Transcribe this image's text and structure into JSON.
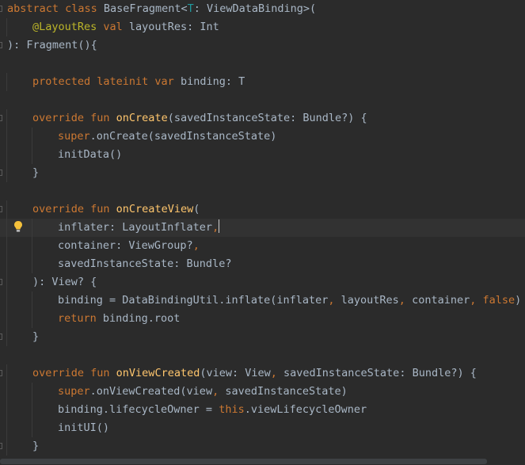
{
  "editor": {
    "language": "Kotlin",
    "theme_colors": {
      "background": "#2b2b2b",
      "keyword": "#cc7832",
      "annotation": "#bbb529",
      "type_parameter": "#20999d",
      "function_declaration": "#ffc66d",
      "plain": "#a9b7c6",
      "current_line": "#323232"
    },
    "current_line": 12,
    "gutter_icons": [
      {
        "line": 12,
        "icon": "intention-bulb-icon"
      }
    ],
    "lines": [
      {
        "indent": 0,
        "fold": true,
        "tokens": [
          {
            "t": "abstract class ",
            "c": "kw"
          },
          {
            "t": "BaseFragment<",
            "c": "pl"
          },
          {
            "t": "T",
            "c": "tp"
          },
          {
            "t": ": ViewDataBinding>(",
            "c": "pl"
          }
        ]
      },
      {
        "indent": 1,
        "tokens": [
          {
            "t": "@LayoutRes ",
            "c": "ann"
          },
          {
            "t": "val ",
            "c": "kw"
          },
          {
            "t": "layoutRes: Int",
            "c": "pl"
          }
        ]
      },
      {
        "indent": 0,
        "fold": true,
        "tokens": [
          {
            "t": "): Fragment(){",
            "c": "pl"
          }
        ]
      },
      {
        "indent": 0,
        "tokens": []
      },
      {
        "indent": 1,
        "tokens": [
          {
            "t": "protected lateinit var ",
            "c": "kw"
          },
          {
            "t": "binding: T",
            "c": "pl"
          }
        ]
      },
      {
        "indent": 0,
        "tokens": []
      },
      {
        "indent": 1,
        "fold": true,
        "tokens": [
          {
            "t": "override fun ",
            "c": "kw"
          },
          {
            "t": "onCreate",
            "c": "fn"
          },
          {
            "t": "(savedInstanceState: Bundle?) {",
            "c": "pl"
          }
        ]
      },
      {
        "indent": 2,
        "tokens": [
          {
            "t": "super",
            "c": "kw"
          },
          {
            "t": ".onCreate(savedInstanceState)",
            "c": "pl"
          }
        ]
      },
      {
        "indent": 2,
        "tokens": [
          {
            "t": "initData()",
            "c": "pl"
          }
        ]
      },
      {
        "indent": 1,
        "fold": true,
        "tokens": [
          {
            "t": "}",
            "c": "pl"
          }
        ]
      },
      {
        "indent": 0,
        "tokens": []
      },
      {
        "indent": 1,
        "fold": true,
        "tokens": [
          {
            "t": "override fun ",
            "c": "kw"
          },
          {
            "t": "onCreateView",
            "c": "fn"
          },
          {
            "t": "(",
            "c": "pl"
          }
        ]
      },
      {
        "indent": 2,
        "caret": true,
        "tokens": [
          {
            "t": "inflater: LayoutInflater",
            "c": "pl"
          },
          {
            "t": ",",
            "c": "kw"
          }
        ]
      },
      {
        "indent": 2,
        "tokens": [
          {
            "t": "container: ViewGroup?",
            "c": "pl"
          },
          {
            "t": ",",
            "c": "kw"
          }
        ]
      },
      {
        "indent": 2,
        "tokens": [
          {
            "t": "savedInstanceState: Bundle?",
            "c": "pl"
          }
        ]
      },
      {
        "indent": 1,
        "fold": true,
        "tokens": [
          {
            "t": "): View? {",
            "c": "pl"
          }
        ]
      },
      {
        "indent": 2,
        "tokens": [
          {
            "t": "binding = DataBindingUtil.inflate(inflater",
            "c": "pl"
          },
          {
            "t": ", ",
            "c": "kw"
          },
          {
            "t": "layoutRes",
            "c": "pl"
          },
          {
            "t": ", ",
            "c": "kw"
          },
          {
            "t": "container",
            "c": "pl"
          },
          {
            "t": ", ",
            "c": "kw"
          },
          {
            "t": "false",
            "c": "kw"
          },
          {
            "t": ")",
            "c": "pl"
          }
        ]
      },
      {
        "indent": 2,
        "tokens": [
          {
            "t": "return ",
            "c": "kw"
          },
          {
            "t": "binding.root",
            "c": "pl"
          }
        ]
      },
      {
        "indent": 1,
        "fold": true,
        "tokens": [
          {
            "t": "}",
            "c": "pl"
          }
        ]
      },
      {
        "indent": 0,
        "tokens": []
      },
      {
        "indent": 1,
        "fold": true,
        "tokens": [
          {
            "t": "override fun ",
            "c": "kw"
          },
          {
            "t": "onViewCreated",
            "c": "fn"
          },
          {
            "t": "(view: View",
            "c": "pl"
          },
          {
            "t": ", ",
            "c": "kw"
          },
          {
            "t": "savedInstanceState: Bundle?) {",
            "c": "pl"
          }
        ]
      },
      {
        "indent": 2,
        "tokens": [
          {
            "t": "super",
            "c": "kw"
          },
          {
            "t": ".onViewCreated(view",
            "c": "pl"
          },
          {
            "t": ", ",
            "c": "kw"
          },
          {
            "t": "savedInstanceState)",
            "c": "pl"
          }
        ]
      },
      {
        "indent": 2,
        "tokens": [
          {
            "t": "binding.lifecycleOwner = ",
            "c": "pl"
          },
          {
            "t": "this",
            "c": "kw"
          },
          {
            "t": ".viewLifecycleOwner",
            "c": "pl"
          }
        ]
      },
      {
        "indent": 2,
        "tokens": [
          {
            "t": "initUI()",
            "c": "pl"
          }
        ]
      },
      {
        "indent": 1,
        "fold": true,
        "tokens": [
          {
            "t": "}",
            "c": "pl"
          }
        ]
      }
    ]
  }
}
